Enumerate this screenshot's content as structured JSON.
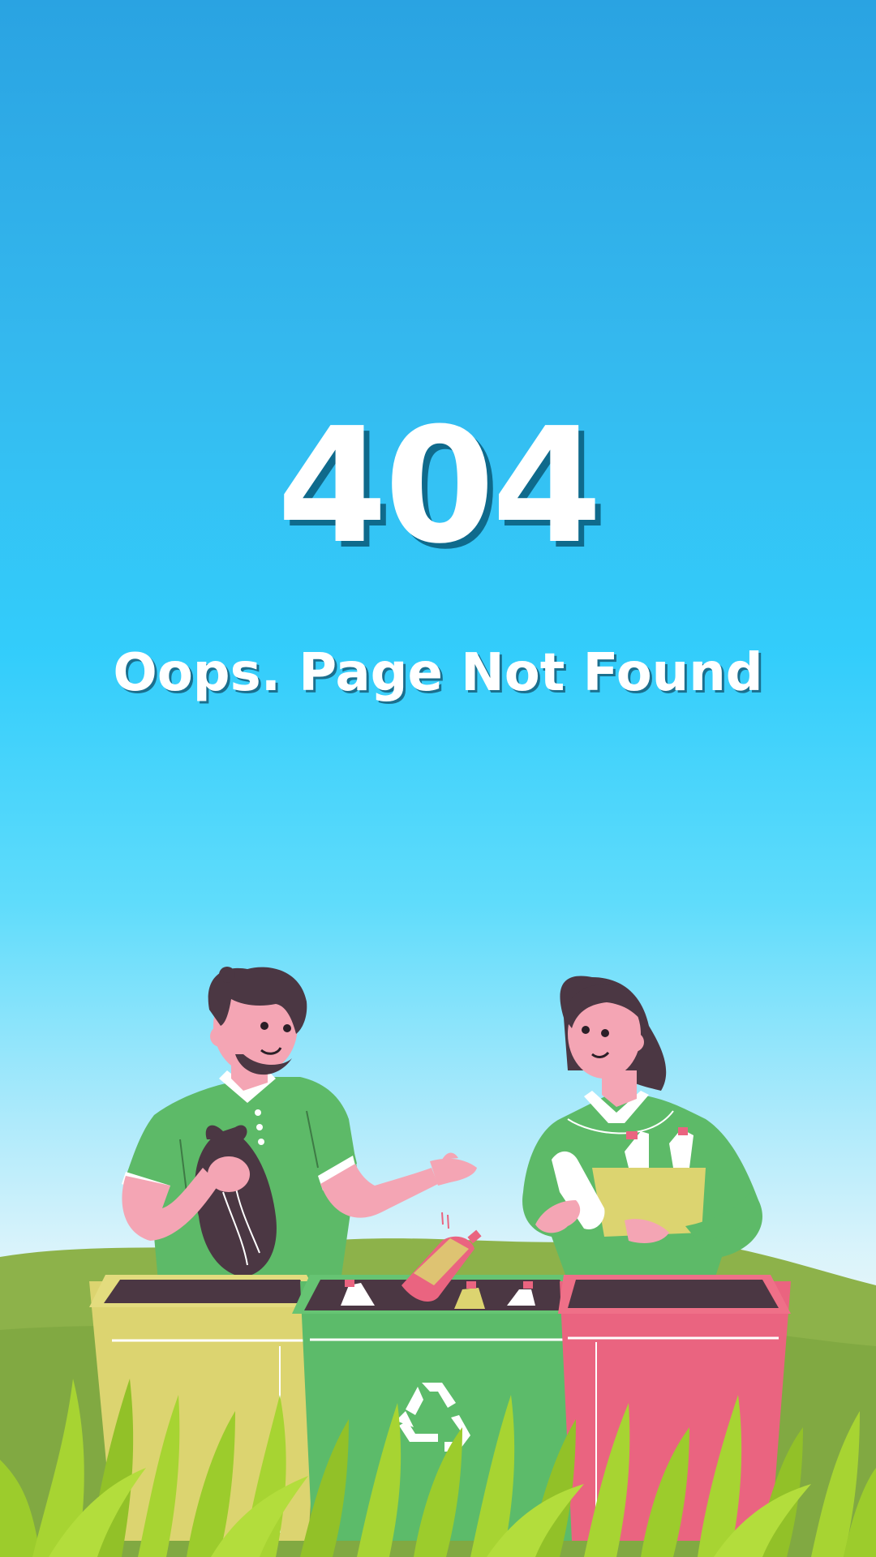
{
  "error": {
    "code": "404",
    "message": "Oops. Page Not Found"
  },
  "illustration": {
    "icons": [
      "recycle-icon"
    ],
    "colors": {
      "sky_top": "#2aa3e2",
      "sky_mid": "#33cdfb",
      "grass": "#8db24a",
      "bin_yellow": "#dcd470",
      "bin_green": "#5cbb6a",
      "bin_red": "#ea6480",
      "shirt": "#5dba68",
      "skin": "#f4a5b4",
      "hair": "#4b3743"
    }
  }
}
